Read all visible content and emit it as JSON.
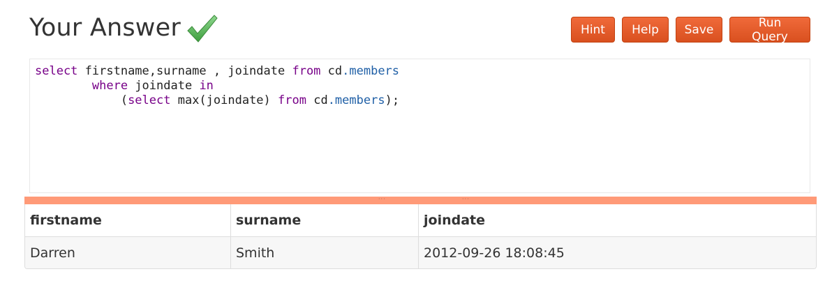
{
  "header": {
    "title": "Your Answer",
    "status_icon": "check-icon",
    "status_color": "#5cb85c"
  },
  "toolbar": {
    "hint_label": "Hint",
    "help_label": "Help",
    "save_label": "Save",
    "run_label": "Run Query",
    "accent_color": "#e0582a"
  },
  "editor": {
    "lines": [
      [
        {
          "type": "kw",
          "text": "select"
        },
        {
          "type": "plain",
          "text": " firstname,surname , joindate "
        },
        {
          "type": "kw",
          "text": "from"
        },
        {
          "type": "plain",
          "text": " cd"
        },
        {
          "type": "prop",
          "text": ".members"
        }
      ],
      [
        {
          "type": "plain",
          "text": "        "
        },
        {
          "type": "kw",
          "text": "where"
        },
        {
          "type": "plain",
          "text": " joindate "
        },
        {
          "type": "kw",
          "text": "in"
        }
      ],
      [
        {
          "type": "plain",
          "text": "            ("
        },
        {
          "type": "kw",
          "text": "select"
        },
        {
          "type": "plain",
          "text": " max(joindate) "
        },
        {
          "type": "kw",
          "text": "from"
        },
        {
          "type": "plain",
          "text": " cd"
        },
        {
          "type": "prop",
          "text": ".members"
        },
        {
          "type": "plain",
          "text": ");"
        }
      ]
    ]
  },
  "splitter": {
    "color": "#ff9a78"
  },
  "results": {
    "columns": [
      "firstname",
      "surname",
      "joindate"
    ],
    "rows": [
      [
        "Darren",
        "Smith",
        "2012-09-26 18:08:45"
      ]
    ]
  }
}
